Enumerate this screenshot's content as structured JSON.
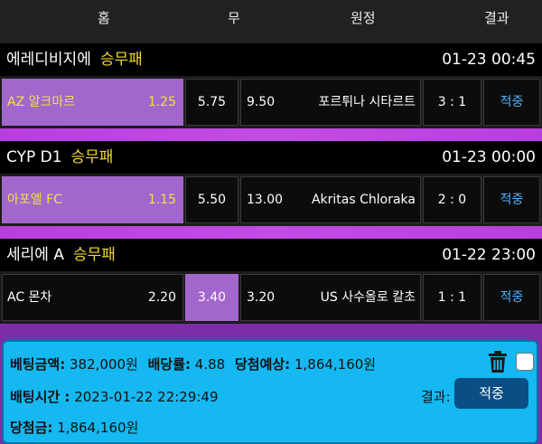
{
  "columns": {
    "home": "홈",
    "draw": "무",
    "away": "원정",
    "result": "결과"
  },
  "games": [
    {
      "league": "에레디비지에",
      "bet_type": "승무패",
      "time": "01-23 00:45",
      "home_team": "AZ 알크마르",
      "home_odd": "1.25",
      "draw_odd": "5.75",
      "away_odd": "9.50",
      "away_team": "포르튀나 시타르트",
      "score": "3 : 1",
      "result": "적중",
      "selected": "home"
    },
    {
      "league": "CYP D1",
      "bet_type": "승무패",
      "time": "01-23 00:00",
      "home_team": "아포엘 FC",
      "home_odd": "1.15",
      "draw_odd": "5.50",
      "away_odd": "13.00",
      "away_team": "Akritas Chloraka",
      "score": "2 : 0",
      "result": "적중",
      "selected": "home"
    },
    {
      "league": "세리에 A",
      "bet_type": "승무패",
      "time": "01-22 23:00",
      "home_team": "AC 몬차",
      "home_odd": "2.20",
      "draw_odd": "3.40",
      "away_odd": "3.20",
      "away_team": "US 사수올로 칼초",
      "score": "1 : 1",
      "result": "적중",
      "selected": "draw"
    }
  ],
  "summary": {
    "bet_amount_label": "베팅금액:",
    "bet_amount": "382,000원",
    "odds_label": "배당률:",
    "odds": "4.88",
    "expected_label": "당첨예상:",
    "expected": "1,864,160원",
    "bet_time_label": "배팅시간 :",
    "bet_time": "2023-01-22 22:29:49",
    "result_label": "결과:",
    "result_button": "적중",
    "win_amount_label": "당첨금:",
    "win_amount": "1,864,160원"
  },
  "colors": {
    "selected": "#a266cc",
    "result_text": "#4fb3ff",
    "summary_bg": "#15b8f0",
    "league_type": "#f0d836"
  },
  "icons": {
    "delete": "trash-icon",
    "select": "checkbox"
  }
}
